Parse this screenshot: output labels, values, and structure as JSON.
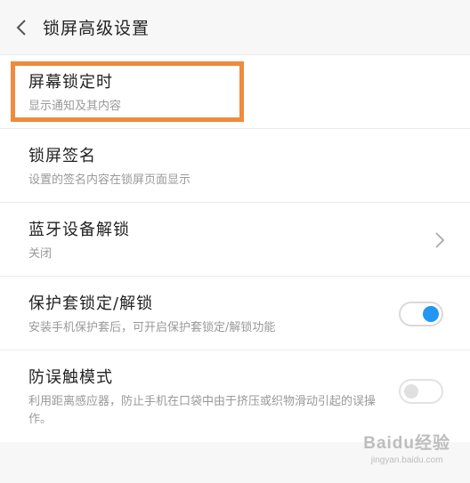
{
  "header": {
    "title": "锁屏高级设置"
  },
  "items": [
    {
      "title": "屏幕锁定时",
      "subtitle": "显示通知及其内容"
    },
    {
      "title": "锁屏签名",
      "subtitle": "设置的签名内容在锁屏页面显示"
    },
    {
      "title": "蓝牙设备解锁",
      "subtitle": "关闭"
    },
    {
      "title": "保护套锁定/解锁",
      "subtitle": "安装手机保护套后，可开启保护套锁定/解锁功能",
      "toggle_on": true
    },
    {
      "title": "防误触模式",
      "subtitle": "利用距离感应器，防止手机在口袋中由于挤压或织物滑动引起的误操作。",
      "toggle_on": false
    }
  ],
  "watermark": {
    "main": "Baidu经验",
    "sub": "jingyan.baidu.com"
  },
  "colors": {
    "highlight": "#f08a3c",
    "toggle_on": "#2196f3"
  }
}
